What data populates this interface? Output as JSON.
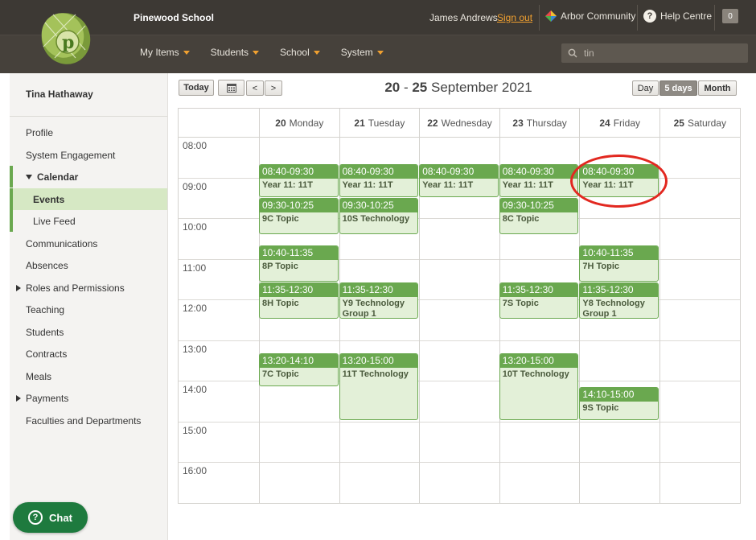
{
  "header": {
    "school_name": "Pinewood School",
    "user_name": "James Andrews",
    "sign_out": "Sign out",
    "arbor_label": "Arbor Community",
    "help_label": "Help Centre",
    "notification_count": "0",
    "help_glyph": "?"
  },
  "nav": {
    "items": [
      "My Items",
      "Students",
      "School",
      "System"
    ]
  },
  "search": {
    "value": "tin"
  },
  "sidebar": {
    "user": "Tina Hathaway",
    "items": [
      "Profile",
      "System Engagement",
      "Calendar",
      "Events",
      "Live Feed",
      "Communications",
      "Absences",
      "Roles and Permissions",
      "Teaching",
      "Students",
      "Contracts",
      "Meals",
      "Payments",
      "Faculties and Departments"
    ]
  },
  "toolbar": {
    "today": "Today",
    "prev": "<",
    "next": ">",
    "range_start": "20",
    "range_sep": " - ",
    "range_end": "25",
    "range_rest": " September 2021",
    "views": [
      "Day",
      "5 days",
      "Month"
    ],
    "selected_view": "5 days"
  },
  "calendar": {
    "days": [
      {
        "num": "20",
        "name": "Monday"
      },
      {
        "num": "21",
        "name": "Tuesday"
      },
      {
        "num": "22",
        "name": "Wednesday"
      },
      {
        "num": "23",
        "name": "Thursday"
      },
      {
        "num": "24",
        "name": "Friday"
      },
      {
        "num": "25",
        "name": "Saturday"
      }
    ],
    "times": [
      "08:00",
      "09:00",
      "10:00",
      "11:00",
      "12:00",
      "13:00",
      "14:00",
      "15:00",
      "16:00"
    ],
    "events": [
      {
        "day": 0,
        "start": "08:40",
        "end": "09:30",
        "time": "08:40-09:30",
        "title": "Year 11: 11T"
      },
      {
        "day": 1,
        "start": "08:40",
        "end": "09:30",
        "time": "08:40-09:30",
        "title": "Year 11: 11T"
      },
      {
        "day": 2,
        "start": "08:40",
        "end": "09:30",
        "time": "08:40-09:30",
        "title": "Year 11: 11T"
      },
      {
        "day": 3,
        "start": "08:40",
        "end": "09:30",
        "time": "08:40-09:30",
        "title": "Year 11: 11T"
      },
      {
        "day": 4,
        "start": "08:40",
        "end": "09:30",
        "time": "08:40-09:30",
        "title": "Year 11: 11T"
      },
      {
        "day": 0,
        "start": "09:30",
        "end": "10:25",
        "time": "09:30-10:25",
        "title": "9C Topic"
      },
      {
        "day": 1,
        "start": "09:30",
        "end": "10:25",
        "time": "09:30-10:25",
        "title": "10S Technology"
      },
      {
        "day": 3,
        "start": "09:30",
        "end": "10:25",
        "time": "09:30-10:25",
        "title": "8C Topic"
      },
      {
        "day": 0,
        "start": "10:40",
        "end": "11:35",
        "time": "10:40-11:35",
        "title": "8P Topic"
      },
      {
        "day": 4,
        "start": "10:40",
        "end": "11:35",
        "time": "10:40-11:35",
        "title": "7H Topic"
      },
      {
        "day": 0,
        "start": "11:35",
        "end": "12:30",
        "time": "11:35-12:30",
        "title": "8H Topic"
      },
      {
        "day": 1,
        "start": "11:35",
        "end": "12:30",
        "time": "11:35-12:30",
        "title": "Y9 Technology Group 1"
      },
      {
        "day": 3,
        "start": "11:35",
        "end": "12:30",
        "time": "11:35-12:30",
        "title": "7S Topic"
      },
      {
        "day": 4,
        "start": "11:35",
        "end": "12:30",
        "time": "11:35-12:30",
        "title": "Y8 Technology Group 1"
      },
      {
        "day": 0,
        "start": "13:20",
        "end": "14:10",
        "time": "13:20-14:10",
        "title": "7C Topic"
      },
      {
        "day": 1,
        "start": "13:20",
        "end": "15:00",
        "time": "13:20-15:00",
        "title": "11T Technology"
      },
      {
        "day": 3,
        "start": "13:20",
        "end": "15:00",
        "time": "13:20-15:00",
        "title": "10T Technology"
      },
      {
        "day": 4,
        "start": "14:10",
        "end": "15:00",
        "time": "14:10-15:00",
        "title": "9S Topic"
      }
    ],
    "highlighted_event": "24 Friday 08:40-09:30"
  },
  "chat": {
    "label": "Chat",
    "glyph": "?"
  },
  "colors": {
    "event_header": "#6aa84f",
    "event_body": "#e3f0d8",
    "accent_orange": "#f0a030",
    "highlight_ring": "#e22820"
  }
}
